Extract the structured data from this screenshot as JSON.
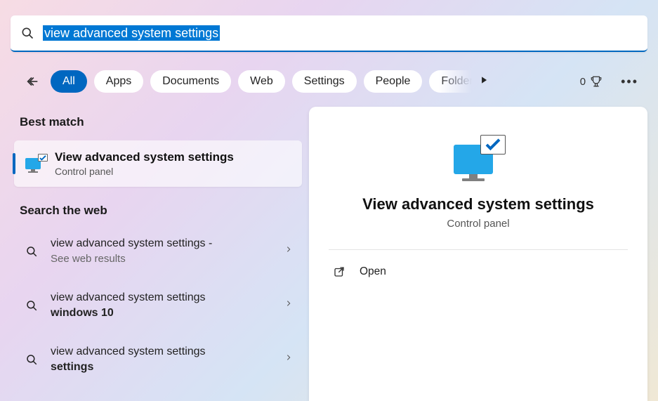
{
  "search": {
    "query": "view advanced system settings",
    "selected": true
  },
  "filters": {
    "items": [
      "All",
      "Apps",
      "Documents",
      "Web",
      "Settings",
      "People",
      "Folders"
    ],
    "active_index": 0
  },
  "rewards": {
    "points": "0"
  },
  "left": {
    "best_match_label": "Best match",
    "best_match": {
      "title": "View advanced system settings",
      "subtitle": "Control panel"
    },
    "web_label": "Search the web",
    "web_items": [
      {
        "prefix": "view advanced system settings",
        "suffix": " - ",
        "bold": "",
        "hint": "See web results"
      },
      {
        "prefix": "view advanced system settings ",
        "suffix": "",
        "bold": "windows 10",
        "hint": ""
      },
      {
        "prefix": "view advanced system settings ",
        "suffix": "",
        "bold": "settings",
        "hint": ""
      }
    ]
  },
  "preview": {
    "title": "View advanced system settings",
    "subtitle": "Control panel",
    "actions": {
      "open": "Open"
    }
  }
}
